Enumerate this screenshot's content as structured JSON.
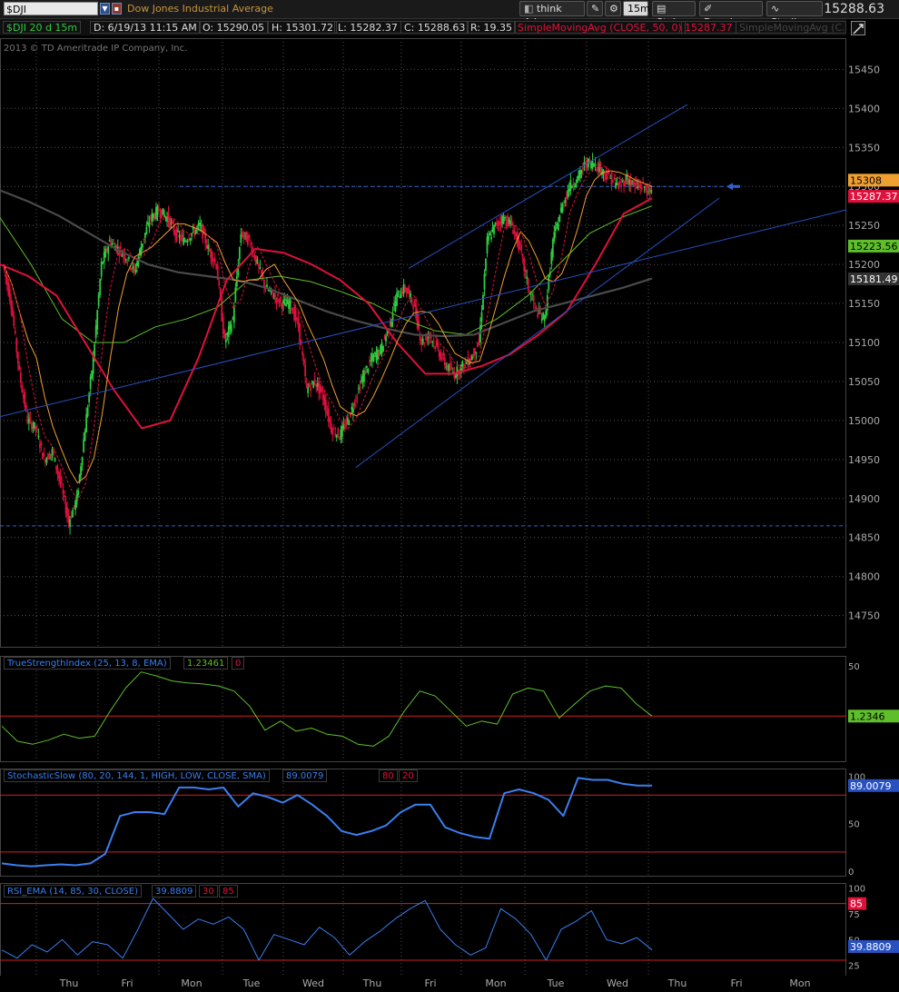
{
  "header": {
    "symbol": "$DJI",
    "symbol_name": "Dow Jones Industrial Average",
    "buttons": {
      "think": "think A.I.",
      "interval": "15m",
      "style": "Style",
      "drawings": "Drawings",
      "studies": "Studies"
    },
    "last_price": "15288.63"
  },
  "info": {
    "symbol_period": "$DJI 20 d 15m",
    "date": "D: 6/19/13 11:15 AM",
    "open": "O: 15290.05",
    "high": "H: 15301.72",
    "low": "L: 15282.37",
    "close": "C: 15288.63",
    "range": "R: 19.35",
    "sma_label": "SimpleMovingAvg (CLOSE, 50, 0)",
    "sma_value": "15287.37",
    "sma2_label": "SimpleMovingAvg (C..."
  },
  "copyright": "2013 © TD Ameritrade IP Company, Inc.",
  "colors": {
    "background": "#000000",
    "up": "#2ecc40",
    "down": "#e0103c",
    "sma50": "#e0103c",
    "sma200": "#555555",
    "green_ma": "#5fbf2a",
    "orange_ma": "#f0a030",
    "trendline": "#2850c0",
    "stoch": "#3a7ff0",
    "rsi": "#3a7ff0",
    "tsi": "#5fbf2a",
    "level": "#d02020"
  },
  "chart_data": [
    {
      "type": "candlestick",
      "title": "Dow Jones Industrial Average",
      "timeframe": "15m",
      "x": [
        "Thu",
        "Fri",
        "Mon",
        "Tue",
        "Wed",
        "Thu",
        "Fri",
        "Mon",
        "Tue",
        "Wed",
        "Thu",
        "Fri",
        "Mon"
      ],
      "ylim": [
        14710,
        15490
      ],
      "y_ticks": [
        15450,
        15400,
        15350,
        15300,
        15250,
        15200,
        15150,
        15100,
        15050,
        15000,
        14950,
        14900,
        14850,
        14800,
        14750
      ],
      "ohlc_path": [
        15200,
        15150,
        15060,
        15000,
        14990,
        14950,
        14960,
        14920,
        14870,
        14900,
        14990,
        15080,
        15200,
        15230,
        15220,
        15210,
        15190,
        15230,
        15260,
        15270,
        15260,
        15240,
        15230,
        15240,
        15250,
        15220,
        15200,
        15100,
        15130,
        15240,
        15230,
        15200,
        15170,
        15160,
        15150,
        15150,
        15120,
        15040,
        15050,
        15030,
        14990,
        14980,
        15000,
        15030,
        15060,
        15080,
        15090,
        15120,
        15160,
        15170,
        15150,
        15100,
        15110,
        15090,
        15070,
        15060,
        15070,
        15080,
        15100,
        15230,
        15250,
        15260,
        15250,
        15220,
        15170,
        15140,
        15130,
        15230,
        15270,
        15300,
        15310,
        15330,
        15330,
        15320,
        15310,
        15300,
        15310,
        15300,
        15300,
        15290
      ],
      "price_labels": {
        "current": "15308",
        "sma50": "15287.37",
        "ma_green": "15223.56",
        "sma200": "15181.49"
      },
      "levels": [
        15300,
        14865
      ],
      "series_paths": {
        "sma200": [
          15295,
          15280,
          15262,
          15240,
          15218,
          15200,
          15190,
          15185,
          15180,
          15170,
          15155,
          15140,
          15128,
          15118,
          15110,
          15108,
          15110,
          15125,
          15140,
          15150,
          15160,
          15170,
          15182
        ],
        "sma50": [
          15200,
          15185,
          15160,
          15100,
          15040,
          14990,
          15000,
          15080,
          15180,
          15220,
          15215,
          15200,
          15180,
          15150,
          15100,
          15060,
          15060,
          15070,
          15085,
          15110,
          15140,
          15200,
          15265,
          15285
        ],
        "ma_green": [
          15260,
          15200,
          15130,
          15100,
          15100,
          15120,
          15130,
          15145,
          15180,
          15185,
          15178,
          15165,
          15150,
          15130,
          15115,
          15110,
          15130,
          15160,
          15200,
          15240,
          15260,
          15275
        ]
      }
    },
    {
      "type": "line",
      "title": "TrueStrengthIndex (25, 13, 8, EMA)",
      "value": "1.23461",
      "signal": "0",
      "value_label": "1.2346",
      "y_ticks": [
        50
      ],
      "zero_line": 0,
      "ylim": [
        -45,
        60
      ],
      "values": [
        -10,
        -25,
        -28,
        -24,
        -18,
        -22,
        -20,
        5,
        28,
        44,
        40,
        35,
        33,
        32,
        30,
        25,
        10,
        -14,
        -5,
        -15,
        -12,
        -18,
        -20,
        -28,
        -30,
        -20,
        5,
        25,
        20,
        5,
        -10,
        -5,
        -8,
        22,
        28,
        25,
        -2,
        12,
        25,
        30,
        28,
        12,
        0
      ]
    },
    {
      "type": "line",
      "title": "StochasticSlow (80, 20, 144, 1, HIGH, LOW, CLOSE, SMA)",
      "value": "89.0079",
      "levels": [
        "80",
        "20"
      ],
      "value_label": "89.0079",
      "y_ticks": [
        100,
        50,
        0
      ],
      "ylim": [
        -5,
        108
      ],
      "values": [
        8,
        6,
        5,
        6,
        7,
        6,
        8,
        18,
        58,
        62,
        62,
        60,
        88,
        88,
        86,
        88,
        68,
        82,
        78,
        72,
        80,
        70,
        58,
        42,
        38,
        42,
        48,
        62,
        70,
        70,
        46,
        40,
        36,
        34,
        82,
        86,
        82,
        75,
        58,
        98,
        96,
        96,
        92,
        90,
        90
      ]
    },
    {
      "type": "line",
      "title": "RSI_EMA (14, 85, 30, CLOSE)",
      "value": "39.8809",
      "levels": [
        "30",
        "85"
      ],
      "value_label": "39.8809",
      "value_label_85": "85",
      "y_ticks": [
        100,
        75,
        50,
        25
      ],
      "ylim": [
        15,
        105
      ],
      "values": [
        40,
        32,
        45,
        38,
        50,
        35,
        48,
        45,
        32,
        60,
        90,
        75,
        60,
        70,
        65,
        72,
        60,
        30,
        55,
        50,
        45,
        62,
        52,
        35,
        48,
        58,
        70,
        80,
        88,
        60,
        45,
        35,
        42,
        80,
        70,
        55,
        30,
        60,
        68,
        78,
        50,
        46,
        52,
        40
      ]
    }
  ],
  "x_axis_labels": [
    "Thu",
    "Fri",
    "Mon",
    "Tue",
    "Wed",
    "Thu",
    "Fri",
    "Mon",
    "Tue",
    "Wed",
    "Thu",
    "Fri",
    "Mon"
  ]
}
